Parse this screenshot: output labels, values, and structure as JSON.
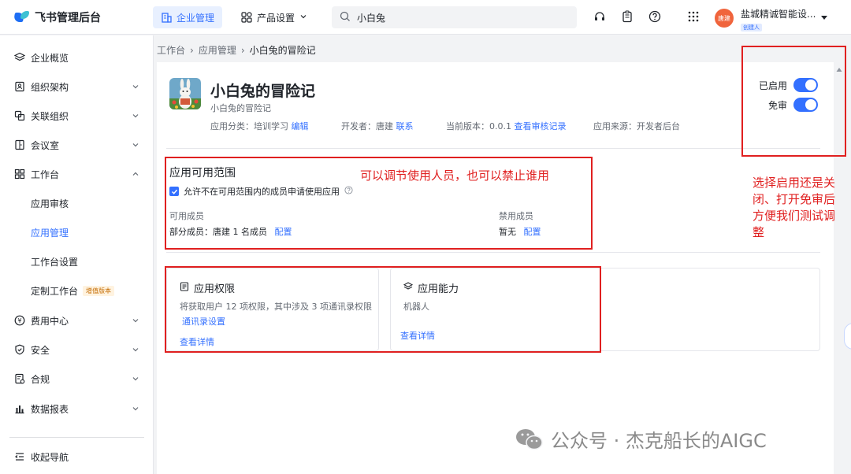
{
  "topbar": {
    "logo_text": "飞书管理后台",
    "nav_active": "企业管理",
    "nav_product": "产品设置",
    "search_value": "小白兔",
    "avatar_text": "唐建",
    "company_name": "盐城精诚智能设...",
    "company_badge": "创建人"
  },
  "sidebar": {
    "items": [
      {
        "label": "企业概览",
        "icon": "layers-icon"
      },
      {
        "label": "组织架构",
        "icon": "org-icon"
      },
      {
        "label": "关联组织",
        "icon": "link-org-icon"
      },
      {
        "label": "会议室",
        "icon": "meeting-room-icon"
      },
      {
        "label": "工作台",
        "icon": "grid-icon"
      }
    ],
    "workbench_sub": [
      "应用审核",
      "应用管理",
      "工作台设置",
      "定制工作台"
    ],
    "value_added_tag": "增值版本",
    "items_after": [
      {
        "label": "费用中心",
        "icon": "coin-icon"
      },
      {
        "label": "安全",
        "icon": "shield-icon"
      },
      {
        "label": "合规",
        "icon": "compliance-icon"
      },
      {
        "label": "数据报表",
        "icon": "chart-icon"
      }
    ],
    "collapse_label": "收起导航"
  },
  "breadcrumb": [
    "工作台",
    "应用管理",
    "小白兔的冒险记"
  ],
  "app": {
    "title": "小白兔的冒险记",
    "subtitle": "小白兔的冒险记",
    "category_label": "应用分类：培训学习",
    "edit_link": "编辑",
    "developer_label": "开发者：唐建",
    "contact_link": "联系",
    "version_label": "当前版本：0.0.1",
    "review_link": "查看审核记录",
    "source_label": "应用来源：开发者后台",
    "enabled_label": "已启用",
    "enabled": true,
    "exempt_label": "免审",
    "exempt": true
  },
  "scope": {
    "title": "应用可用范围",
    "checkbox_label": "允许不在可用范围内的成员申请使用应用",
    "checked": true,
    "available_label": "可用成员",
    "available_value": "部分成员：唐建 1 名成员",
    "available_config": "配置",
    "banned_label": "禁用成员",
    "banned_value": "暂无",
    "banned_config": "配置"
  },
  "cards": {
    "perm_title": "应用权限",
    "perm_desc": "将获取用户 12 项权限，其中涉及 3 项通讯录权限",
    "perm_link1": "通讯录设置",
    "perm_link2": "查看详情",
    "ability_title": "应用能力",
    "ability_desc": "机器人",
    "ability_link": "查看详情"
  },
  "annotations": {
    "scope_note": "可以调节使用人员，也可以禁止谁用",
    "toggle_note_lines": [
      "选择启用还是关",
      "闭、打开免审后",
      "方便我们测试调",
      "整"
    ]
  },
  "watermark": {
    "text": "公众号 · 杰克船长的AIGC"
  },
  "colors": {
    "accent": "#3370ff",
    "annotation": "#e02020"
  }
}
